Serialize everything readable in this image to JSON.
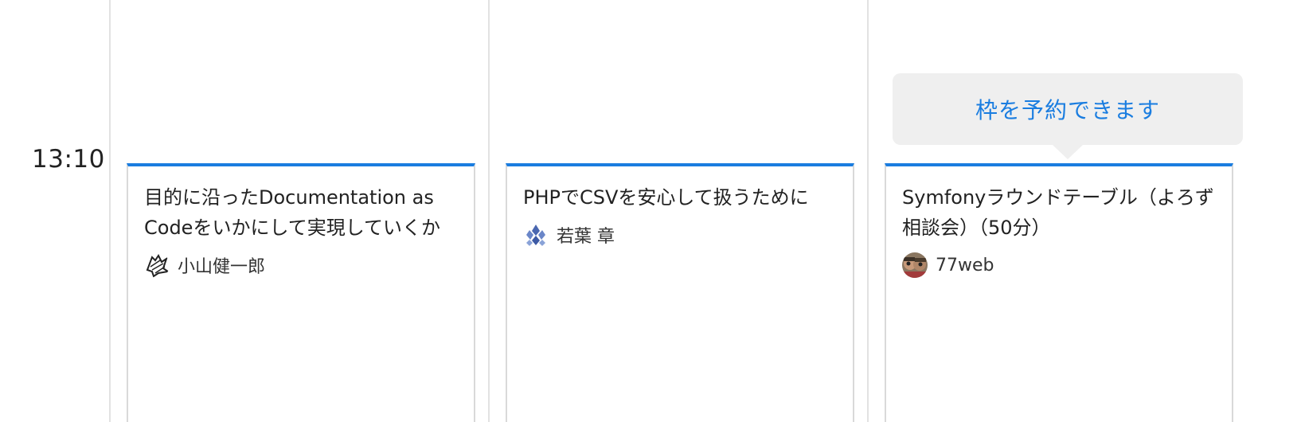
{
  "timeslot": {
    "time": "13:10"
  },
  "booking_tooltip": {
    "label": "枠を予約できます"
  },
  "sessions": [
    {
      "title": "目的に沿ったDocumentation as Codeをいかにして実現していくか",
      "speaker": "小山健一郎",
      "avatar_icon": "sketch-avatar-icon"
    },
    {
      "title": "PHPでCSVを安心して扱うために",
      "speaker": "若葉 章",
      "avatar_icon": "crystal-avatar-icon"
    },
    {
      "title": "Symfonyラウンドテーブル（よろず相談会）（50分）",
      "speaker": "77web",
      "avatar_icon": "photo-avatar-icon"
    }
  ],
  "colors": {
    "accent": "#1a7de0",
    "tooltip_bg": "#efefef",
    "grid_line": "#e2e2e2"
  }
}
